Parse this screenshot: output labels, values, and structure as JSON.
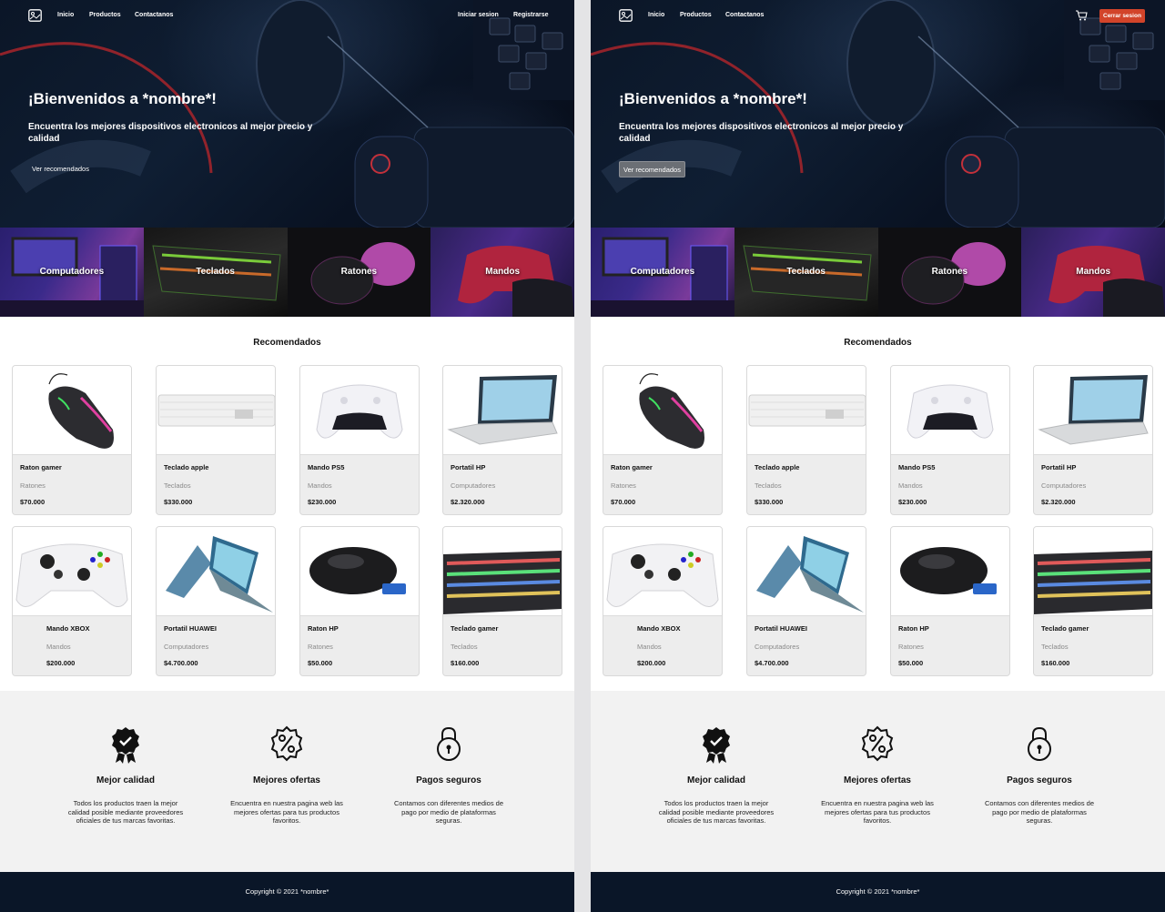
{
  "left": {
    "nav": {
      "links": [
        "Inicio",
        "Productos",
        "Contactanos"
      ],
      "login_label": "Iniciar sesion",
      "register_label": "Registrarse"
    },
    "hero": {
      "title": "¡Bienvenidos a *nombre*!",
      "subtitle": "Encuentra los mejores dispositivos electronicos al mejor precio y calidad",
      "button_label": "Ver recomendados"
    }
  },
  "right": {
    "nav": {
      "links": [
        "Inicio",
        "Productos",
        "Contactanos"
      ],
      "logout_label": "Cerrar sesion"
    },
    "hero": {
      "title": "¡Bienvenidos a *nombre*!",
      "subtitle": "Encuentra los mejores dispositivos electronicos al mejor precio y calidad",
      "button_label": "Ver recomendados"
    }
  },
  "categories": [
    "Computadores",
    "Teclados",
    "Ratones",
    "Mandos"
  ],
  "recommended_title": "Recomendados",
  "products": [
    {
      "name": "Raton gamer",
      "category": "Ratones",
      "price": "$70.000"
    },
    {
      "name": "Teclado apple",
      "category": "Teclados",
      "price": "$330.000"
    },
    {
      "name": "Mando PS5",
      "category": "Mandos",
      "price": "$230.000"
    },
    {
      "name": "Portatil HP",
      "category": "Computadores",
      "price": "$2.320.000"
    },
    {
      "name": "Mando XBOX",
      "category": "Mandos",
      "price": "$200.000"
    },
    {
      "name": "Portatil HUAWEI",
      "category": "Computadores",
      "price": "$4.700.000"
    },
    {
      "name": "Raton HP",
      "category": "Ratones",
      "price": "$50.000"
    },
    {
      "name": "Teclado gamer",
      "category": "Teclados",
      "price": "$160.000"
    }
  ],
  "features": [
    {
      "title": "Mejor calidad",
      "description": "Todos los productos traen la mejor calidad posible mediante proveedores oficiales de tus marcas favoritas.",
      "icon": "award-icon"
    },
    {
      "title": "Mejores ofertas",
      "description": "Encuentra en nuestra pagina web las mejores ofertas para tus productos favoritos.",
      "icon": "discount-icon"
    },
    {
      "title": "Pagos seguros",
      "description": "Contamos con diferentes medios de pago por medio de plataformas seguras.",
      "icon": "lock-icon"
    }
  ],
  "footer": {
    "copyright": "Copyright © 2021 *nombre*"
  },
  "colors": {
    "logout_button": "#d2442a",
    "footer_bg": "#0a1628",
    "features_bg": "#f2f2f2"
  }
}
